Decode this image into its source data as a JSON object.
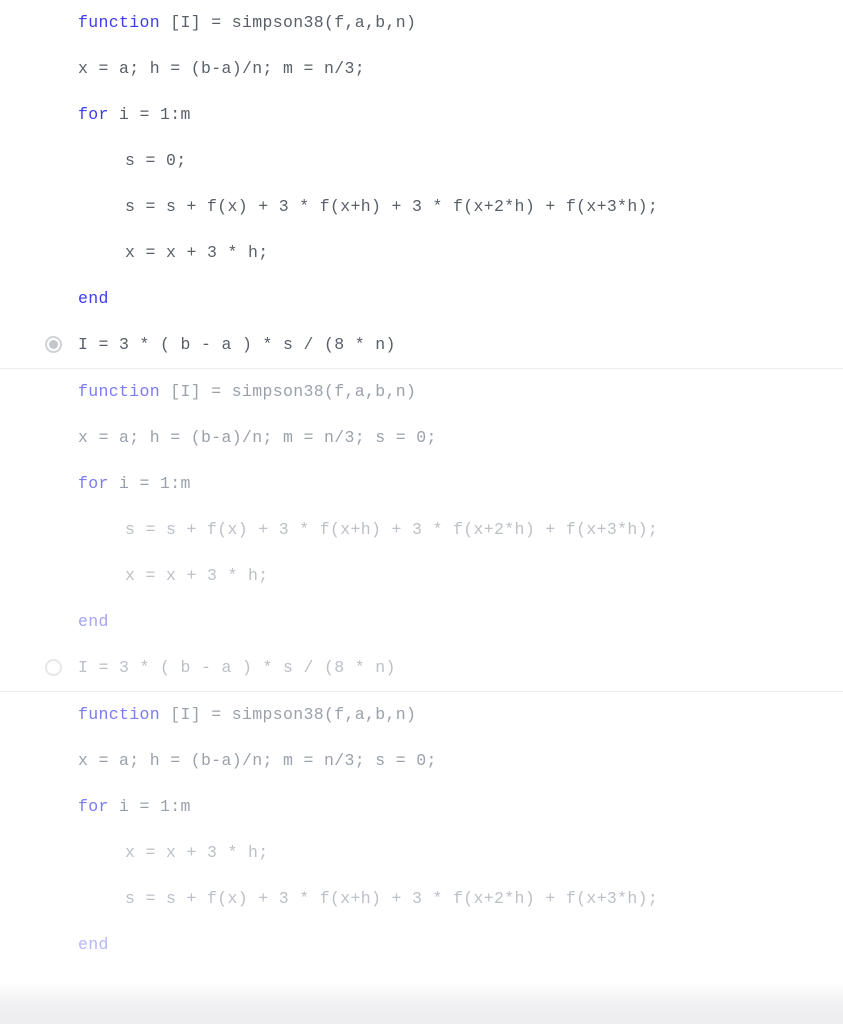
{
  "page": {
    "background_color": "#ffffff",
    "divider_color": "#ececee",
    "keyword_color": "#3c3cf0",
    "text_color": "#5a6069"
  },
  "options": [
    {
      "id": "option-1",
      "selected": true,
      "radio_state": "checked",
      "lines": [
        {
          "indent": 0,
          "fade": 0,
          "keyword": "function",
          "rest": " [I] = simpson38(f,a,b,n)",
          "text": "function [I] = simpson38(f,a,b,n)"
        },
        {
          "indent": 0,
          "fade": 0,
          "keyword": "",
          "rest": "x = a; h = (b-a)/n; m = n/3;",
          "text": "x = a; h = (b-a)/n; m = n/3;"
        },
        {
          "indent": 0,
          "fade": 0,
          "keyword": "for",
          "rest": " i = 1:m",
          "text": "for i = 1:m"
        },
        {
          "indent": 1,
          "fade": 0,
          "keyword": "",
          "rest": "s = 0;",
          "text": "s = 0;"
        },
        {
          "indent": 1,
          "fade": 0,
          "keyword": "",
          "rest": "s = s + f(x) + 3 * f(x+h) + 3 * f(x+2*h) + f(x+3*h);",
          "text": "s = s + f(x) + 3 * f(x+h) + 3 * f(x+2*h) + f(x+3*h);"
        },
        {
          "indent": 1,
          "fade": 0,
          "keyword": "",
          "rest": "x = x + 3 * h;",
          "text": "x = x + 3 * h;"
        },
        {
          "indent": 0,
          "fade": 0,
          "keyword": "end",
          "rest": "",
          "text": "end"
        }
      ],
      "answer_line": {
        "indent": 0,
        "fade": 0,
        "text": "I = 3 * ( b - a ) * s / (8 * n)"
      }
    },
    {
      "id": "option-2",
      "selected": false,
      "radio_state": "unchecked",
      "lines": [
        {
          "indent": 0,
          "fade": 1,
          "keyword": "function",
          "rest": " [I] = simpson38(f,a,b,n)",
          "text": "function [I] = simpson38(f,a,b,n)"
        },
        {
          "indent": 0,
          "fade": 1,
          "keyword": "",
          "rest": "x = a; h = (b-a)/n; m = n/3; s = 0;",
          "text": "x = a; h = (b-a)/n; m = n/3; s = 0;"
        },
        {
          "indent": 0,
          "fade": 1,
          "keyword": "for",
          "rest": " i = 1:m",
          "text": "for i = 1:m"
        },
        {
          "indent": 1,
          "fade": 2,
          "keyword": "",
          "rest": "s = s + f(x) + 3 * f(x+h) + 3 * f(x+2*h) + f(x+3*h);",
          "text": "s = s + f(x) + 3 * f(x+h) + 3 * f(x+2*h) + f(x+3*h);"
        },
        {
          "indent": 1,
          "fade": 2,
          "keyword": "",
          "rest": "x = x + 3 * h;",
          "text": "x = x + 3 * h;"
        },
        {
          "indent": 0,
          "fade": 2,
          "keyword": "end",
          "rest": "",
          "text": "end"
        }
      ],
      "answer_line": {
        "indent": 0,
        "fade": 2,
        "text": "I = 3 * ( b - a ) * s / (8 * n)"
      }
    },
    {
      "id": "option-3",
      "selected": false,
      "radio_state": "none",
      "lines": [
        {
          "indent": 0,
          "fade": 1,
          "keyword": "function",
          "rest": " [I] = simpson38(f,a,b,n)",
          "text": "function [I] = simpson38(f,a,b,n)"
        },
        {
          "indent": 0,
          "fade": 1,
          "keyword": "",
          "rest": "x = a; h = (b-a)/n; m = n/3; s = 0;",
          "text": "x = a; h = (b-a)/n; m = n/3; s = 0;"
        },
        {
          "indent": 0,
          "fade": 1,
          "keyword": "for",
          "rest": " i = 1:m",
          "text": "for i = 1:m"
        },
        {
          "indent": 1,
          "fade": 2,
          "keyword": "",
          "rest": "x = x + 3 * h;",
          "text": "x = x + 3 * h;"
        },
        {
          "indent": 1,
          "fade": 2,
          "keyword": "",
          "rest": "s = s + f(x) + 3 * f(x+h) + 3 * f(x+2*h) + f(x+3*h);",
          "text": "s = s + f(x) + 3 * f(x+h) + 3 * f(x+2*h) + f(x+3*h);"
        },
        {
          "indent": 0,
          "fade": 3,
          "keyword": "end",
          "rest": "",
          "text": "end"
        }
      ],
      "answer_line": null
    }
  ]
}
